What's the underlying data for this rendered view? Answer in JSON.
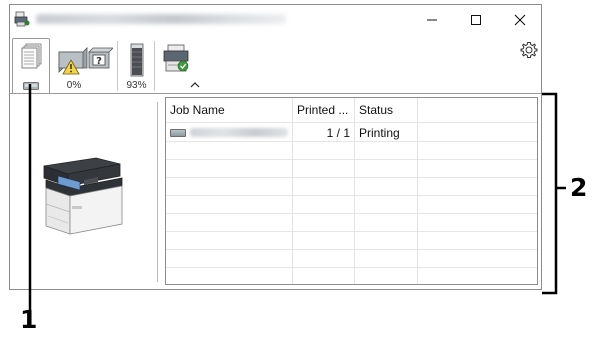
{
  "window": {
    "controls": {
      "minimize": "—",
      "maximize": "☐",
      "close": "✕"
    }
  },
  "toolbar": {
    "tabs": [
      {
        "icon": "job-queue-icon",
        "label": ""
      },
      {
        "icon": "toner-warning-icon",
        "label": "0%"
      },
      {
        "icon": "toner-level-icon",
        "label": "93%"
      },
      {
        "icon": "printer-status-icon",
        "label": ""
      }
    ],
    "settings_icon": "gear-icon",
    "collapse_icon": "chevron-up-icon"
  },
  "joblist": {
    "columns": [
      "Job Name",
      "Printed ...",
      "Status"
    ],
    "rows": [
      {
        "job_name": "",
        "printed": "1 / 1",
        "status": "Printing"
      }
    ]
  },
  "callouts": {
    "left": "1",
    "right": "2"
  },
  "colors": {
    "window_border": "#8c8c8c",
    "grid_line": "#e6e6e6"
  }
}
